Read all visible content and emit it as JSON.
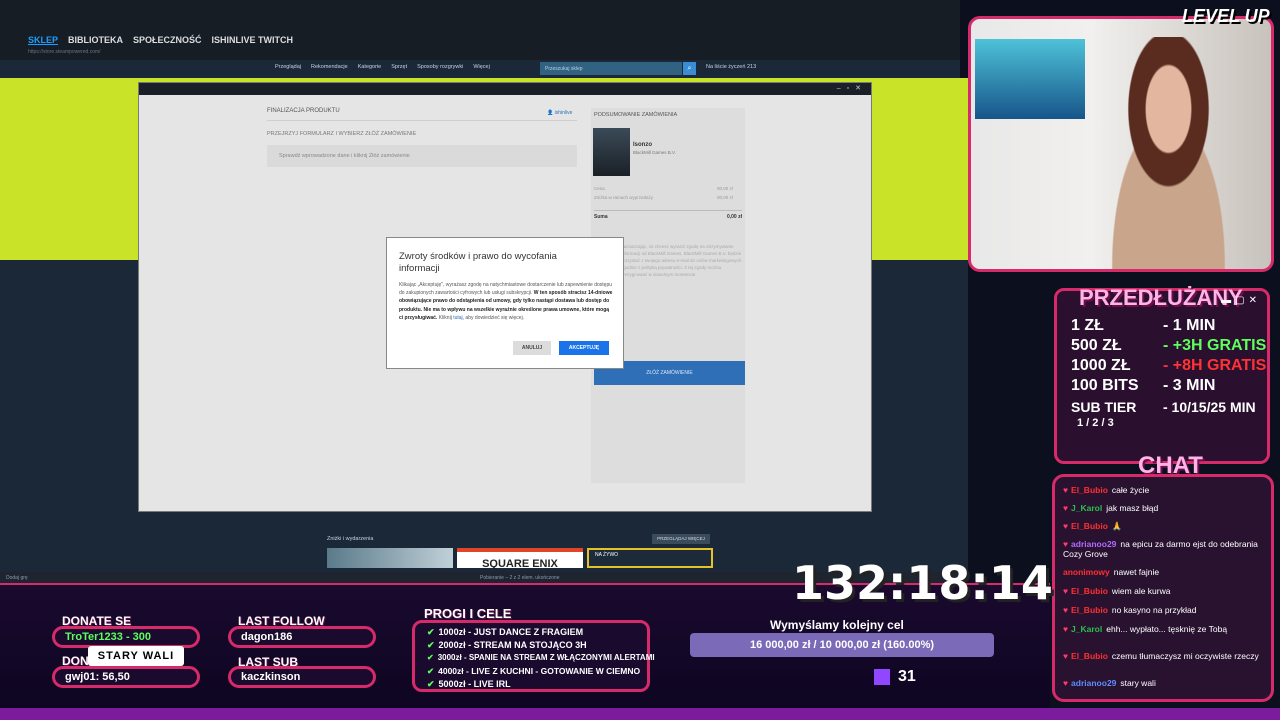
{
  "steam": {
    "tabs": [
      "SKLEP",
      "BIBLIOTEKA",
      "SPOŁECZNOŚĆ",
      "ISHINLIVE TWITCH"
    ],
    "url": "https://store.steampowered.com/",
    "menu": [
      "Przeglądaj",
      "Rekomendacje",
      "Kategorie",
      "Sprzęt",
      "Sposoby rozgrywki",
      "Więcej"
    ],
    "search_placeholder": "Przeszukaj sklep",
    "wishlist": "Na liście życzeń 213",
    "deals_label": "Zniżki i wydarzenia",
    "more_button": "PRZEGLĄDAJ WIĘCEJ",
    "tile_label": "SQUARE ENIX",
    "live_label": "NA ŻYWO",
    "taskbar_left": "Dodaj grę",
    "taskbar_mid": "Pobieranie – 2 z 2 elem. ukończone"
  },
  "purchase": {
    "left_heading": "FINALIZACJA PRODUKTU",
    "left_subheading": "PRZEJRZYJ FORMULARZ I WYBIERZ ZŁÓŻ ZAMÓWIENIE",
    "left_box": "Sprawdź wprowadzone dane i kliknij Złóż zamówienie",
    "user_label": "ishinlive",
    "right_heading": "PODSUMOWANIE ZAMÓWIENIA",
    "game_name": "Isonzo",
    "publisher": "BlackMill Games B.V.",
    "price_line1": "Cena",
    "price_line1_val": "00,00 zł",
    "price_line2": "Zniżka w ramach wyprzedaży",
    "price_line2_val": "00,00 zł",
    "sum_label": "Suma",
    "sum_value": "0,00 zł",
    "legal": "Zaznaczając, że chcesz wyrazić zgodę na otrzymywanie informacji od BlackMill Games, BlackMill Games B.V. będzie korzystać z twojego adresu e-mail do celów marketingowych zgodnie z polityką prywatności. Z tej zgody można zrezygnować w dowolnym momencie.",
    "order_button": "ZŁÓŻ ZAMÓWIENIE"
  },
  "dialog": {
    "title": "Zwroty środków i prawo do wycofania informacji",
    "body_plain": "Klikając „Akceptuję\", wyrażasz zgodę na natychmiastowe dostarczenie lub zapewnienie dostępu do zakupionych zawartości cyfrowych lub usługi subskrypcji. ",
    "body_bold": "W ten sposób stracisz 14-dniowe obowiązujące prawo do odstąpienia od umowy, gdy tylko nastąpi dostawa lub dostęp do produktu. Nie ma to wpływu na wszelkie wyraźnie określone prawa umowne, które mogą ci przysługiwać.",
    "body_tail1": " Kliknij ",
    "body_link": "tutaj",
    "body_tail2": ", aby dowiedzieć się więcej.",
    "cancel": "ANULUJ",
    "accept": "AKCEPTUJĘ"
  },
  "overlay": {
    "level_up": "LEVEL UP",
    "promo_head": "PRZEDŁUŻANY",
    "promo_rows": [
      {
        "left": "1 ZŁ",
        "right": "- 1 MIN"
      },
      {
        "left": "500 ZŁ",
        "right": "- +3H GRATIS"
      },
      {
        "left": "1000 ZŁ",
        "right": "- +8H GRATIS"
      },
      {
        "left": "100 BITS",
        "right": "- 3 MIN"
      },
      {
        "left": "SUB TIER",
        "right": "- 10/15/25 MIN"
      }
    ],
    "sub_tiers": "1 / 2 / 3",
    "chat_head": "CHAT",
    "chat": [
      {
        "user": "El_Bubio",
        "text": "całe życie"
      },
      {
        "user": "J_Karol",
        "text": "jak masz błąd"
      },
      {
        "user": "El_Bubio",
        "text": "🙏"
      },
      {
        "user": "adrianoo29",
        "text": "na epicu za darmo ejst do odebrania Cozy Grove"
      },
      {
        "user": "anonimowy",
        "text": "nawet fajnie"
      },
      {
        "user": "El_Bubio",
        "text": "wiem ale kurwa"
      },
      {
        "user": "El_Bubio",
        "text": "no kasyno na przykład"
      },
      {
        "user": "J_Karol",
        "text": "ehh... wypłato... tęsknię ze Tobą"
      },
      {
        "user": "El_Bubio",
        "text": "czemu tłumaczysz mi oczywiste rzeczy"
      },
      {
        "user": "adrianoo29",
        "text": "stary wali"
      }
    ],
    "timer": "132:18:14",
    "donate_label": "DONATE SE",
    "donate_value": "TroTer1233 - 300",
    "donate2_label": "DONA",
    "donate2_value": "gwj01: 56,50",
    "stary_wali": "STARY WALI",
    "last_follow_label": "LAST FOLLOW",
    "last_follow_value": "dagon186",
    "last_sub_label": "LAST SUB",
    "last_sub_value": "kaczkinson",
    "goals_head": "PROGI I CELE",
    "goals": [
      "1000zł - JUST DANCE Z FRAGIEM",
      "2000zł - STREAM NA STOJĄCO 3H",
      "3000zł - SPANIE NA STREAM Z WŁĄCZONYMI ALERTAMI",
      "4000zł - LIVE Z KUCHNI - GOTOWANIE W CIEMNO",
      "5000zł - LIVE IRL"
    ],
    "target_title": "Wymyślamy kolejny cel",
    "target_bar": "16 000,00 zł / 10 000,00 zł (160.00%)",
    "viewers": "31"
  },
  "colors": {
    "accent": "#d72a6a",
    "steam_blue": "#1a9fff",
    "lime": "#c9e329"
  }
}
